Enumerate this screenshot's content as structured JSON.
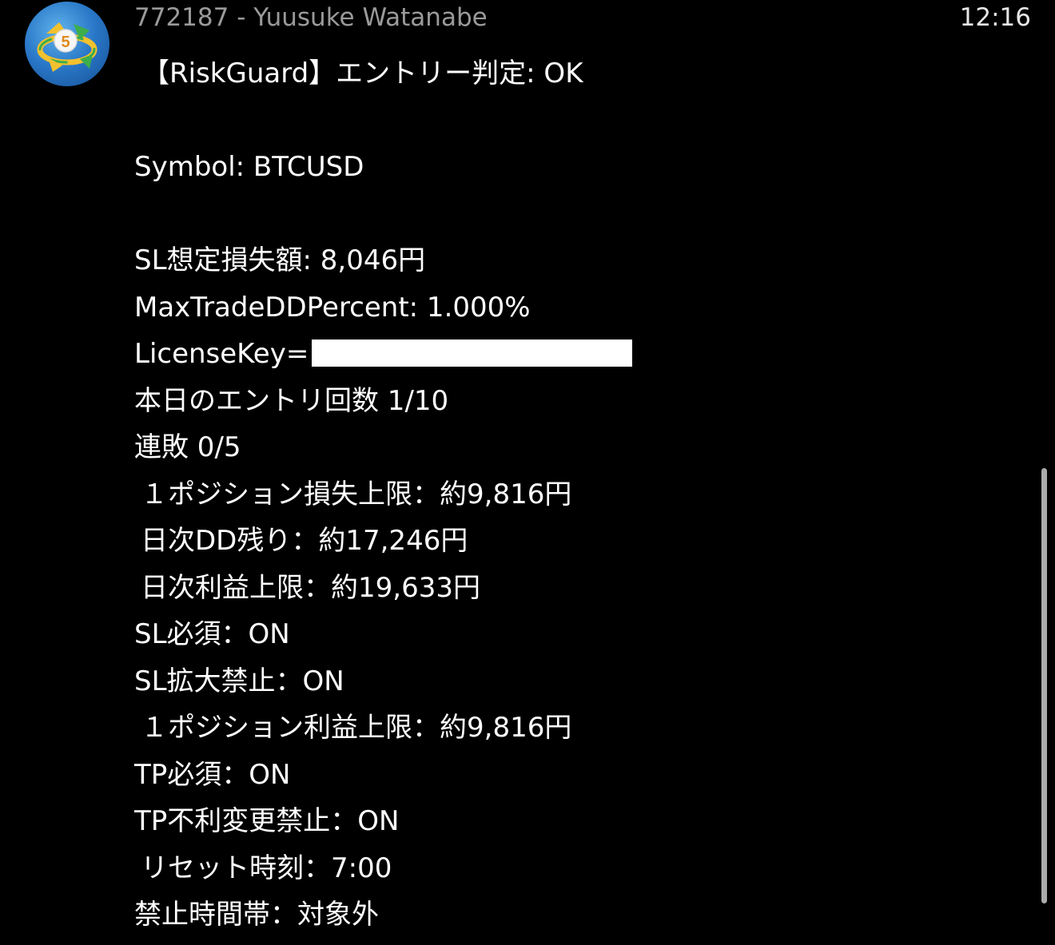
{
  "header": {
    "sender": "772187 - Yuusuke Watanabe",
    "time": "12:16",
    "avatar_icon": "metatrader5-icon"
  },
  "message": {
    "title": "【RiskGuard】エントリー判定: OK",
    "symbol": "Symbol: BTCUSD",
    "sl_loss": "SL想定損失額: 8,046円",
    "max_dd": "MaxTradeDDPercent: 1.000%",
    "license_label": "LicenseKey=",
    "entries_today": "本日のエントリ回数  1/10",
    "losing_streak": "連敗  0/5",
    "position_loss_limit": "１ポジション損失上限：約9,816円",
    "daily_dd_remaining": "日次DD残り：約17,246円",
    "daily_profit_limit": "日次利益上限：約19,633円",
    "sl_required": "SL必須：ON",
    "sl_widen_forbidden": "SL拡大禁止：ON",
    "position_profit_limit": "１ポジション利益上限：約9,816円",
    "tp_required": "TP必須：ON",
    "tp_unfavorable_change_forbidden": "TP不利変更禁止：ON",
    "reset_time": "リセット時刻：7:00",
    "forbidden_hours": "禁止時間帯：対象外"
  },
  "colors": {
    "background": "#000000",
    "text": "#ffffff",
    "sender": "#9a9a9a",
    "scrollbar": "#ababab"
  }
}
